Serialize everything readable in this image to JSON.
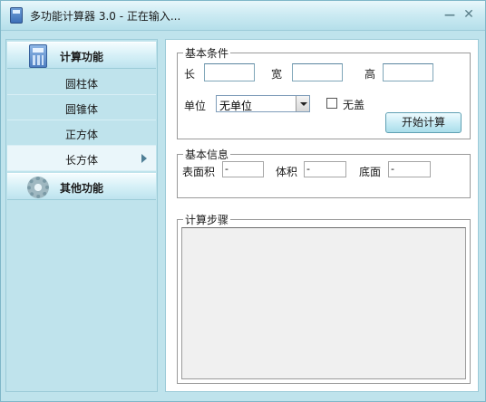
{
  "window": {
    "title": "多功能计算器 3.0 - 正在输入..."
  },
  "sidebar": {
    "groups": [
      {
        "label": "计算功能",
        "icon": "calculator-icon",
        "items": [
          {
            "label": "圆柱体"
          },
          {
            "label": "圆锥体"
          },
          {
            "label": "正方体"
          },
          {
            "label": "长方体",
            "selected": true
          }
        ]
      },
      {
        "label": "其他功能",
        "icon": "gear-icon"
      }
    ]
  },
  "conditions": {
    "legend": "基本条件",
    "length_label": "长",
    "width_label": "宽",
    "height_label": "高",
    "length_value": "",
    "width_value": "",
    "height_value": "",
    "unit_label": "单位",
    "unit_value": "无单位",
    "no_lid_label": "无盖",
    "no_lid_checked": false,
    "start_button": "开始计算"
  },
  "info": {
    "legend": "基本信息",
    "surface_label": "表面积",
    "surface_value": "-",
    "volume_label": "体积",
    "volume_value": "-",
    "base_label": "底面",
    "base_value": "-"
  },
  "steps": {
    "legend": "计算步骤",
    "content": ""
  },
  "colors": {
    "window_bg": "#bfe3ec",
    "accent": "#9ccbd8",
    "selected_item_bg": "#eaf6fa"
  }
}
